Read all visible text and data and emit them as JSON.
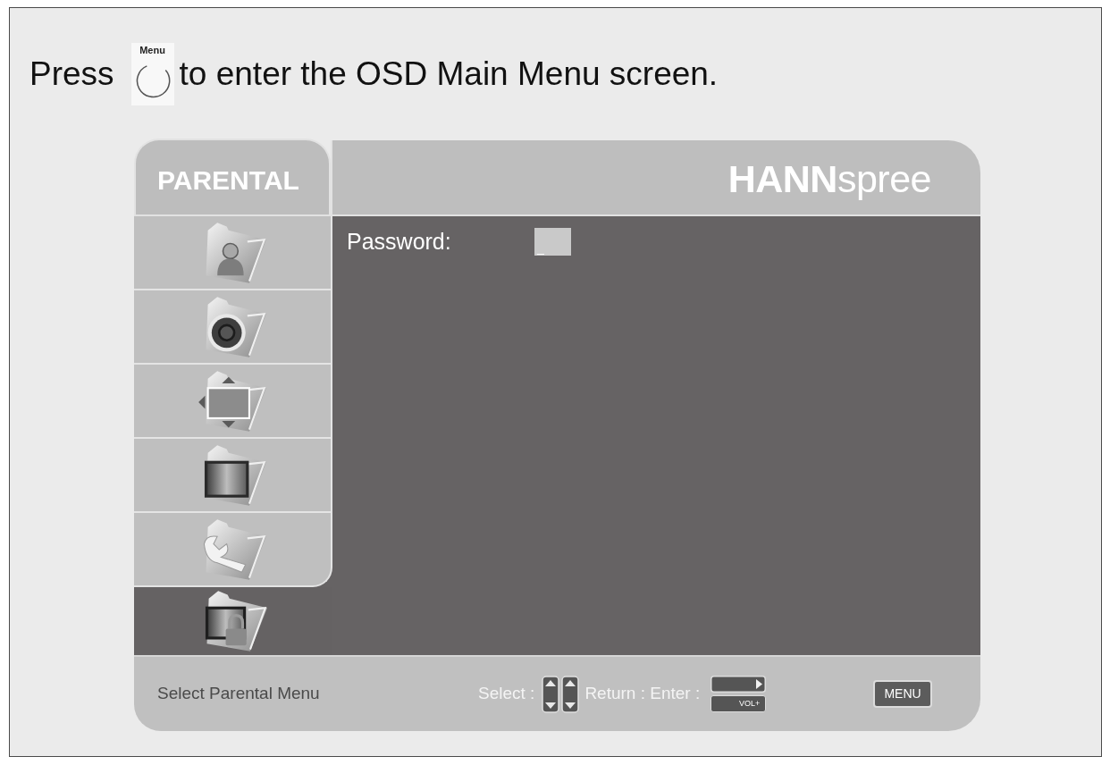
{
  "instruction": {
    "before": "Press",
    "key_label": "Menu",
    "after": "to enter the OSD Main Menu screen."
  },
  "osd": {
    "title": "PARENTAL",
    "logo": "**HANN**spree",
    "sidebar": {
      "items": [
        {
          "kind": "picture",
          "selected": false
        },
        {
          "kind": "sound",
          "selected": false
        },
        {
          "kind": "position",
          "selected": false
        },
        {
          "kind": "screen",
          "selected": false
        },
        {
          "kind": "setup",
          "selected": false
        },
        {
          "kind": "lock",
          "selected": true
        }
      ]
    },
    "content": {
      "fields": [
        {
          "label": "Password:",
          "value": "_"
        }
      ]
    },
    "footer": {
      "hint": "Select Parental Menu",
      "select_label": "Select :",
      "return_enter_label": "Return : Enter :",
      "enter_key_label": "VOL+",
      "menu_key": "MENU"
    }
  }
}
